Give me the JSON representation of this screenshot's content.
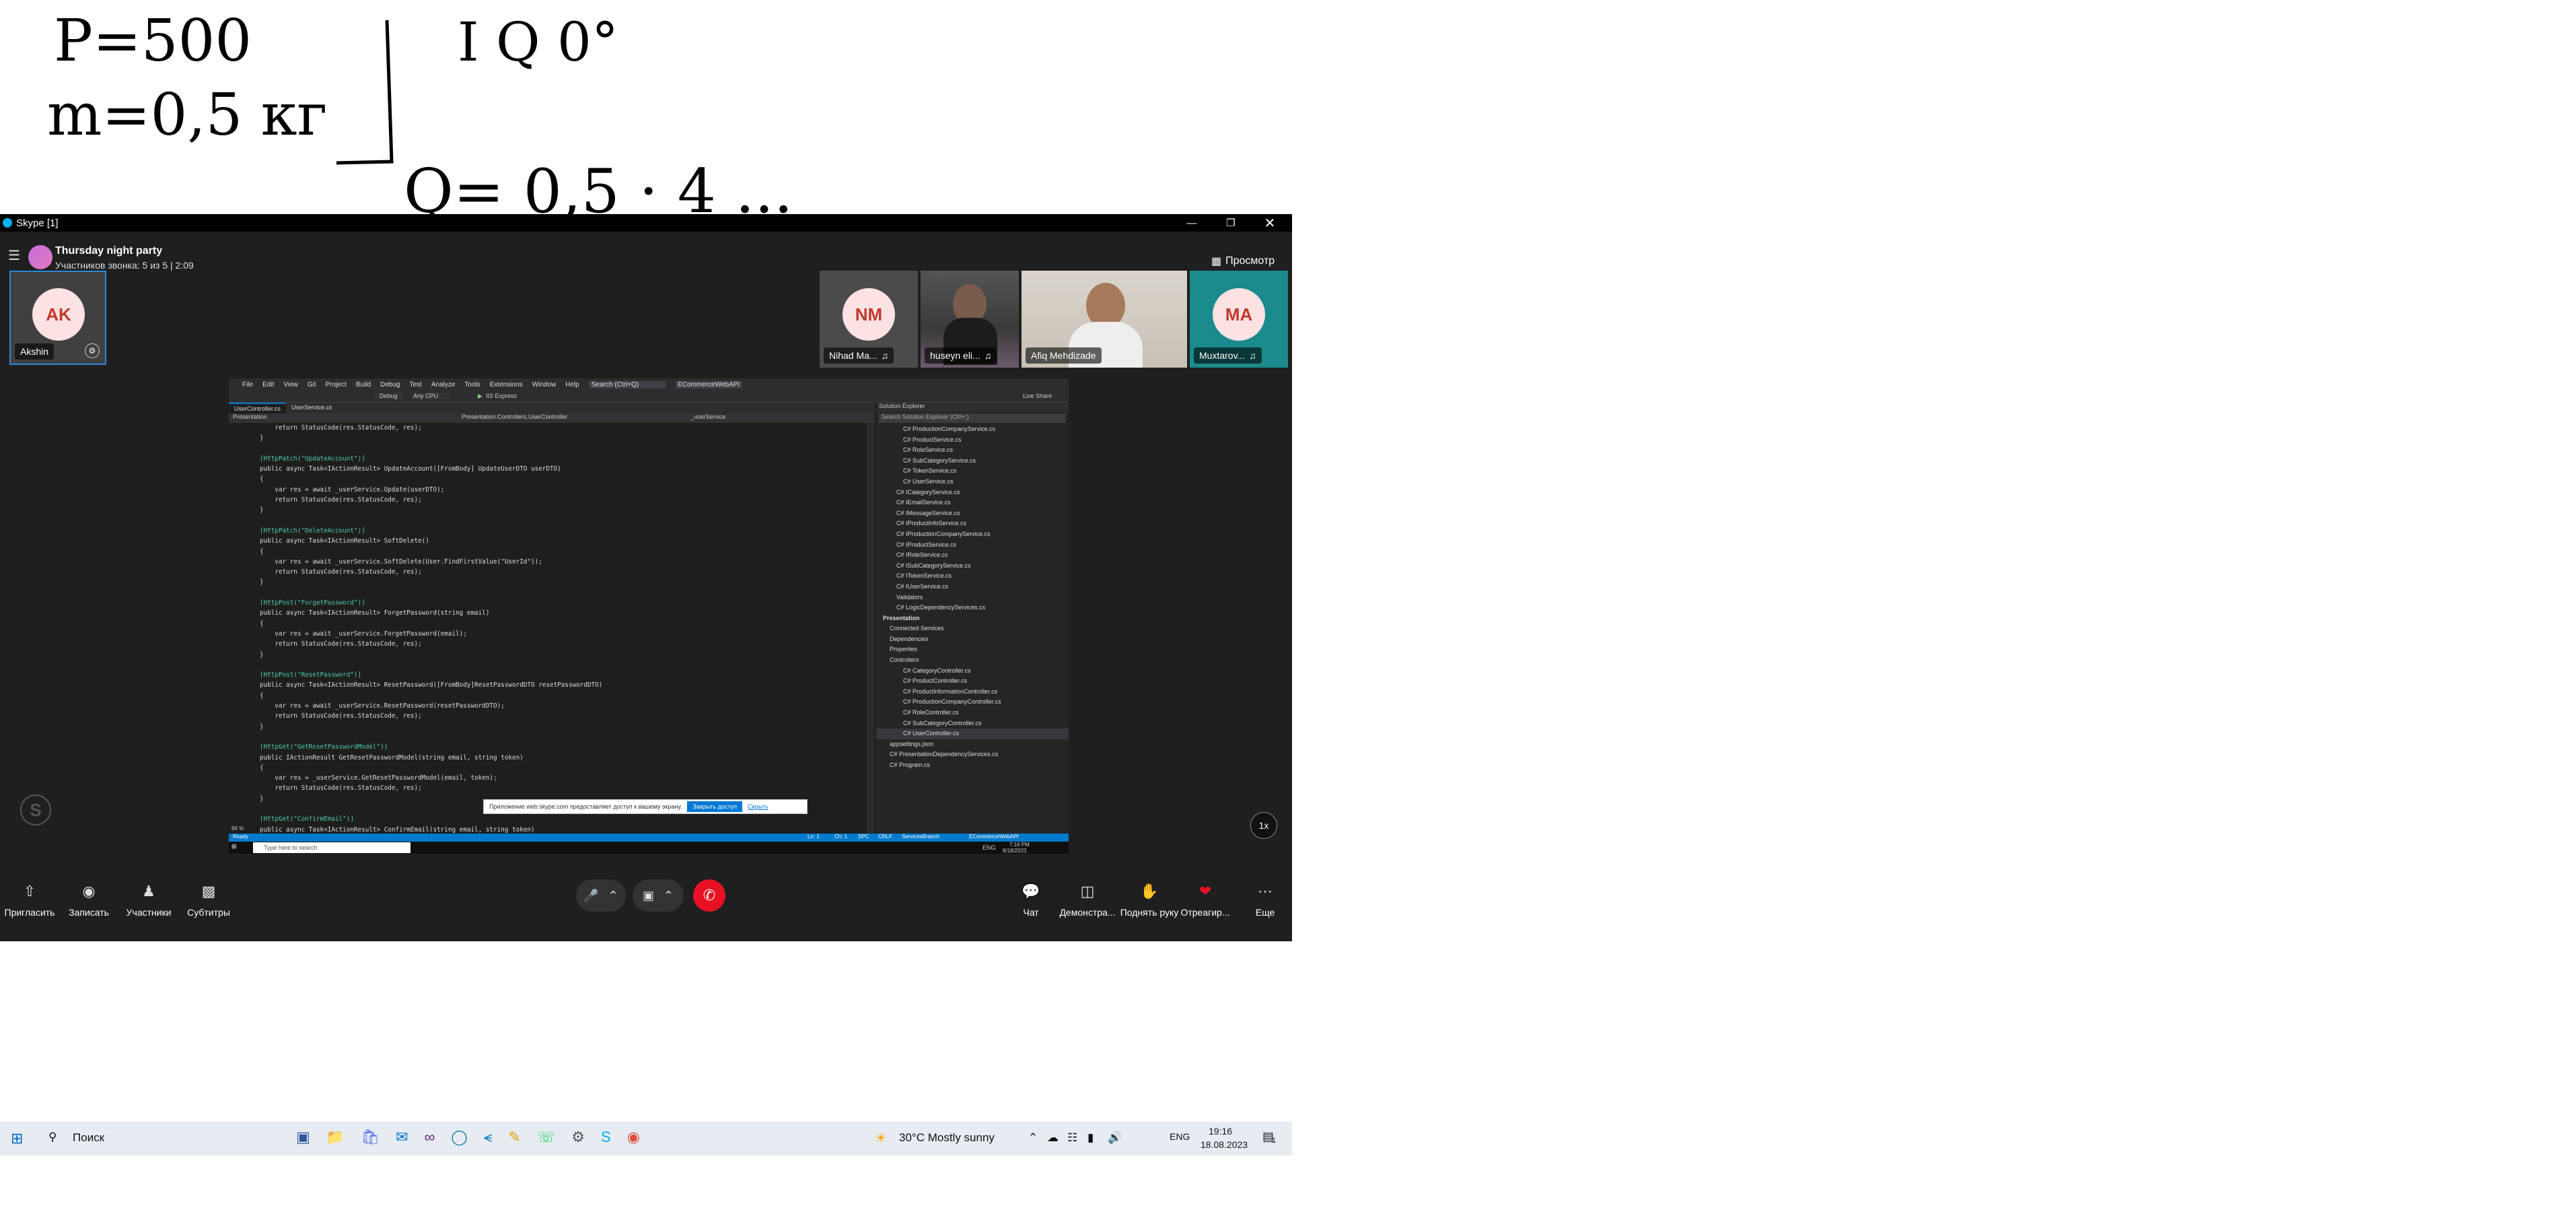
{
  "whiteboard": {
    "line1": "P=500",
    "line2": "m=0,5 кг",
    "line3": "I   Q   0°",
    "line4": "Q= 0,5 · 4 ..."
  },
  "skype": {
    "window_title": "Skype [1]",
    "call_title": "Thursday night party",
    "call_subtitle": "Участников звонка: 5 из 5 | 2:09",
    "view_label": "Просмотр",
    "self_tile": {
      "initials": "AK",
      "name": "Akshin"
    },
    "participants": [
      {
        "initials": "NM",
        "name": "Nihad Ma...",
        "has_video": false
      },
      {
        "initials": "",
        "name": "huseyn eli...",
        "has_video": true
      },
      {
        "initials": "",
        "name": "Afiq Mehdizade",
        "has_video": true
      },
      {
        "initials": "MA",
        "name": "Muxtarov...",
        "has_video": false
      }
    ],
    "speed_badge": "1x",
    "controls_left": [
      {
        "label": "Пригласить",
        "icon": "share-icon"
      },
      {
        "label": "Записать",
        "icon": "record-icon"
      },
      {
        "label": "Участники",
        "icon": "people-icon"
      },
      {
        "label": "Субтитры",
        "icon": "subtitles-icon"
      }
    ],
    "controls_right": [
      {
        "label": "Чат",
        "icon": "chat-icon"
      },
      {
        "label": "Демонстра...",
        "icon": "screen-share-icon"
      },
      {
        "label": "Поднять руку",
        "icon": "raise-hand-icon"
      },
      {
        "label": "Отреагир...",
        "icon": "react-icon"
      },
      {
        "label": "Еще",
        "icon": "more-icon"
      }
    ]
  },
  "vs": {
    "menu": [
      "File",
      "Edit",
      "View",
      "Git",
      "Project",
      "Build",
      "Debug",
      "Test",
      "Analyze",
      "Tools",
      "Extensions",
      "Window",
      "Help",
      "Search (Ctrl+Q)",
      "ECommerceWebAPI"
    ],
    "config": "Debug",
    "platform": "Any CPU",
    "run_target": "IIS Express",
    "live_share": "Live Share",
    "tabs": [
      "UserController.cs",
      "UserService.cs"
    ],
    "nav": [
      "Presentation",
      "Presentation.Controllers.UserController",
      "_userService"
    ],
    "line_numbers": [
      "46",
      "47",
      "48",
      "49",
      "50",
      "51",
      "52",
      "53",
      "54",
      "55",
      "56",
      "57",
      "58",
      "59",
      "60",
      "61",
      "62",
      "63",
      "64",
      "65",
      "66",
      "67",
      "68",
      "69",
      "70",
      "71",
      "72",
      "73",
      "74",
      "75",
      "76",
      "77",
      "78",
      "79",
      "80",
      "81",
      "82",
      "83",
      "84",
      "85"
    ],
    "code": [
      "    return StatusCode(res.StatusCode, res);",
      "}",
      "",
      "[HttpPatch(\"UpdateAccount\")]",
      "public async Task<IActionResult> UpdateAccount([FromBody] UpdateUserDTO userDTO)",
      "{",
      "    var res = await _userService.Update(userDTO);",
      "    return StatusCode(res.StatusCode, res);",
      "}",
      "",
      "[HttpPatch(\"DeleteAccount\")]",
      "public async Task<IActionResult> SoftDelete()",
      "{",
      "    var res = await _userService.SoftDelete(User.FindFirstValue(\"UserId\"));",
      "    return StatusCode(res.StatusCode, res);",
      "}",
      "",
      "[HttpPost(\"ForgetPassword\")]",
      "public async Task<IActionResult> ForgetPassword(string email)",
      "{",
      "    var res = await _userService.ForgetPassword(email);",
      "    return StatusCode(res.StatusCode, res);",
      "}",
      "",
      "[HttpPost(\"ResetPassword\")]",
      "public async Task<IActionResult> ResetPassword([FromBody]ResetPasswordDTO resetPasswordDTO)",
      "{",
      "    var res = await _userService.ResetPassword(resetPasswordDTO);",
      "    return StatusCode(res.StatusCode, res);",
      "}",
      "",
      "[HttpGet(\"GetResetPasswordModel\")]",
      "public IActionResult GetResetPasswordModel(string email, string token)",
      "{",
      "    var res = _userService.GetResetPasswordModel(email, token);",
      "    return StatusCode(res.StatusCode, res);",
      "}",
      "",
      "[HttpGet(\"ConfirmEmail\")]",
      "public async Task<IActionResult> ConfirmEmail(string email, string token)"
    ],
    "solution_explorer": {
      "title": "Solution Explorer",
      "search": "Search Solution Explorer (Ctrl+;)",
      "items": [
        "C# ProductionCompanyService.cs",
        "C# ProductService.cs",
        "C# RoleService.cs",
        "C# SubCategoryService.cs",
        "C# TokenService.cs",
        "C# UserService.cs",
        "C# ICategoryService.cs",
        "C# IEmailService.cs",
        "C# IMessageService.cs",
        "C# IProductInfoService.cs",
        "C# IProductionCompanyService.cs",
        "C# IProductService.cs",
        "C# IRoleService.cs",
        "C# ISubCategoryService.cs",
        "C# ITokenService.cs",
        "C# IUserService.cs",
        "Validators",
        "C# LogicDependencyServices.cs",
        "Presentation",
        "Connected Services",
        "Dependencies",
        "Properties",
        "Controllers",
        "C# CategoryController.cs",
        "C# ProductController.cs",
        "C# ProductInformationController.cs",
        "C# ProductionCompanyController.cs",
        "C# RoleController.cs",
        "C# SubCategoryController.cs",
        "C# UserController.cs",
        "appsettings.json",
        "C# PresentationDependencyServices.cs",
        "C# Program.cs"
      ]
    },
    "status_left": "Ready",
    "zoom": "96 %",
    "status_right": [
      "Ln: 1",
      "Ch: 1",
      "SPC",
      "CRLF"
    ],
    "branch": "ServicesBranch",
    "repo": "ECommerceWebAPI",
    "inner_search": "Type here to search",
    "inner_lang": "ENG",
    "inner_time": "7:16 PM",
    "inner_date": "8/18/2023",
    "notification": {
      "text": "Приложение web.skype.com предоставляет доступ к вашему экрану.",
      "button": "Закрыть доступ",
      "link": "Скрыть"
    }
  },
  "taskbar": {
    "search_label": "Поиск",
    "weather": "30°C  Mostly sunny",
    "lang": "ENG",
    "time": "19:16",
    "date": "18.08.2023",
    "notif_count": "1"
  }
}
